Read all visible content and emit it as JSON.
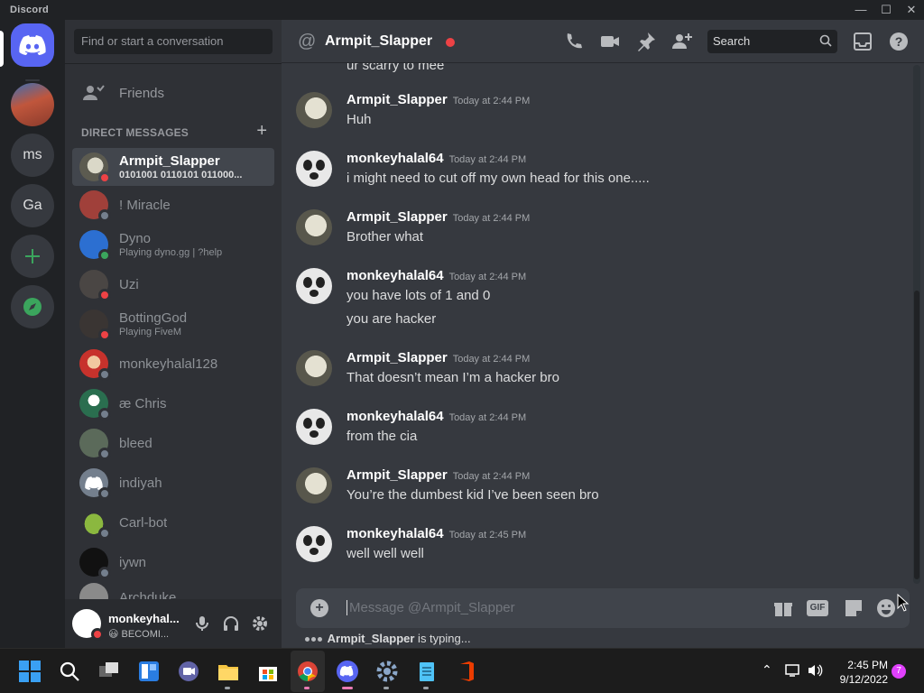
{
  "app": {
    "title": "Discord"
  },
  "servers": [
    {
      "label": ""
    },
    {
      "label": "ms"
    },
    {
      "label": "Ga"
    }
  ],
  "sidebar": {
    "search_placeholder": "Find or start a conversation",
    "friends_label": "Friends",
    "dm_header": "DIRECT MESSAGES",
    "dms": [
      {
        "name": "Armpit_Slapper",
        "sub": "0101001 0110101 011000...",
        "status": "dnd",
        "color": "#6b6a5c"
      },
      {
        "name": "! Miracle",
        "sub": "",
        "status": "offline",
        "color": "#a0403a"
      },
      {
        "name": "Dyno",
        "sub": "Playing dyno.gg | ?help",
        "status": "online",
        "color": "#2c6fd1"
      },
      {
        "name": "Uzi",
        "sub": "",
        "status": "dnd",
        "color": "#4a4644"
      },
      {
        "name": "BottingGod",
        "sub": "Playing FiveM",
        "status": "dnd",
        "color": "#3a3533"
      },
      {
        "name": "monkeyhalal128",
        "sub": "",
        "status": "offline",
        "color": "#c7322c"
      },
      {
        "name": "æ Chris",
        "sub": "",
        "status": "offline",
        "color": "#2a6e4f"
      },
      {
        "name": "bleed",
        "sub": "",
        "status": "offline",
        "color": "#5b6a5a"
      },
      {
        "name": "indiyah",
        "sub": "",
        "status": "offline",
        "color": "#747f8d"
      },
      {
        "name": "Carl-bot",
        "sub": "",
        "status": "offline",
        "color": "#7fa33a"
      },
      {
        "name": "iywn",
        "sub": "",
        "status": "offline",
        "color": "#111111"
      },
      {
        "name": "Archduke",
        "sub": "",
        "status": "offline",
        "color": "#8a8a8a"
      }
    ]
  },
  "user_panel": {
    "name": "monkeyhal...",
    "status": "BECOMI..."
  },
  "channel": {
    "title": "Armpit_Slapper",
    "search_placeholder": "Search"
  },
  "chat": {
    "partial_top": "ur scarry to mee",
    "messages": [
      {
        "author": "Armpit_Slapper",
        "time": "Today at 2:44 PM",
        "lines": [
          "Huh"
        ],
        "avatar": "a"
      },
      {
        "author": "monkeyhalal64",
        "time": "Today at 2:44 PM",
        "lines": [
          "i might need to cut off my own head for this one....."
        ],
        "avatar": "b"
      },
      {
        "author": "Armpit_Slapper",
        "time": "Today at 2:44 PM",
        "lines": [
          "Brother what"
        ],
        "avatar": "a"
      },
      {
        "author": "monkeyhalal64",
        "time": "Today at 2:44 PM",
        "lines": [
          "you have lots of 1 and 0",
          "you are hacker"
        ],
        "avatar": "b"
      },
      {
        "author": "Armpit_Slapper",
        "time": "Today at 2:44 PM",
        "lines": [
          "That doesn’t mean I’m a hacker bro"
        ],
        "avatar": "a"
      },
      {
        "author": "monkeyhalal64",
        "time": "Today at 2:44 PM",
        "lines": [
          "from the cia"
        ],
        "avatar": "b"
      },
      {
        "author": "Armpit_Slapper",
        "time": "Today at 2:44 PM",
        "lines": [
          "You’re the dumbest kid I’ve been seen bro"
        ],
        "avatar": "a"
      },
      {
        "author": "monkeyhalal64",
        "time": "Today at 2:45 PM",
        "lines": [
          "well well well"
        ],
        "avatar": "b"
      }
    ],
    "composer_placeholder": "Message @Armpit_Slapper",
    "gif_label": "GIF",
    "typing_user": "Armpit_Slapper",
    "typing_suffix": " is typing..."
  },
  "taskbar": {
    "time": "2:45 PM",
    "date": "9/12/2022",
    "notifications": "7"
  }
}
